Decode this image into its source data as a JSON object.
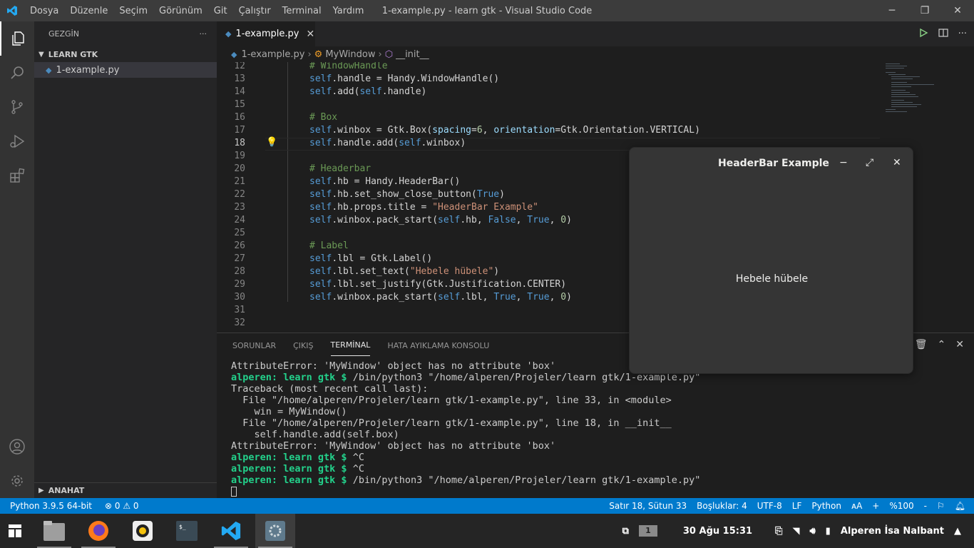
{
  "window": {
    "title": "1-example.py - learn gtk - Visual Studio Code",
    "menu": [
      "Dosya",
      "Düzenle",
      "Seçim",
      "Görünüm",
      "Git",
      "Çalıştır",
      "Terminal",
      "Yardım"
    ]
  },
  "sidebar": {
    "header": "GEZGİN",
    "more": "···",
    "folder": "LEARN GTK",
    "file": "1-example.py",
    "outline": "ANAHAT"
  },
  "editor": {
    "tab": "1-example.py",
    "breadcrumb": [
      "1-example.py",
      "MyWindow",
      "__init__"
    ],
    "current_line": 18
  },
  "panel": {
    "tabs": [
      "SORUNLAR",
      "ÇIKIŞ",
      "TERMİNAL",
      "HATA AYIKLAMA KONSOLU"
    ],
    "active_tab": "TERMİNAL",
    "terminal": {
      "l1": "AttributeError: 'MyWindow' object has no attribute 'box'",
      "prompt": "alperen: learn gtk $",
      "cmd1": " /bin/python3 \"/home/alperen/Projeler/learn gtk/1-example.py\"",
      "l3": "Traceback (most recent call last):",
      "l4": "  File \"/home/alperen/Projeler/learn gtk/1-example.py\", line 33, in <module>",
      "l5": "    win = MyWindow()",
      "l6": "  File \"/home/alperen/Projeler/learn gtk/1-example.py\", line 18, in __init__",
      "l7": "    self.handle.add(self.box)",
      "l8": "AttributeError: 'MyWindow' object has no attribute 'box'",
      "ctrlc": " ^C"
    }
  },
  "statusbar": {
    "interpreter": "Python 3.9.5 64-bit",
    "problems": "⊗ 0 ⚠ 0",
    "position": "Satır 18, Sütun 33",
    "spaces": "Boşluklar: 4",
    "encoding": "UTF-8",
    "eol": "LF",
    "language": "Python",
    "az": "ᴀA",
    "plus": "+",
    "zoom": "%100",
    "minus": "-"
  },
  "gtk_window": {
    "title": "HeaderBar Example",
    "minimize": "−",
    "maximize": "⤢",
    "close": "✕",
    "label": "Hebele hübele"
  },
  "taskbar": {
    "workspace": "1",
    "clock": "30 Ağu  15:31",
    "user": "Alperen İsa Nalbant"
  },
  "colors": {
    "accent": "#007acc",
    "prompt_green": "#23d18b",
    "comment": "#6a9955",
    "keyword": "#569cd6",
    "string": "#ce9178"
  }
}
